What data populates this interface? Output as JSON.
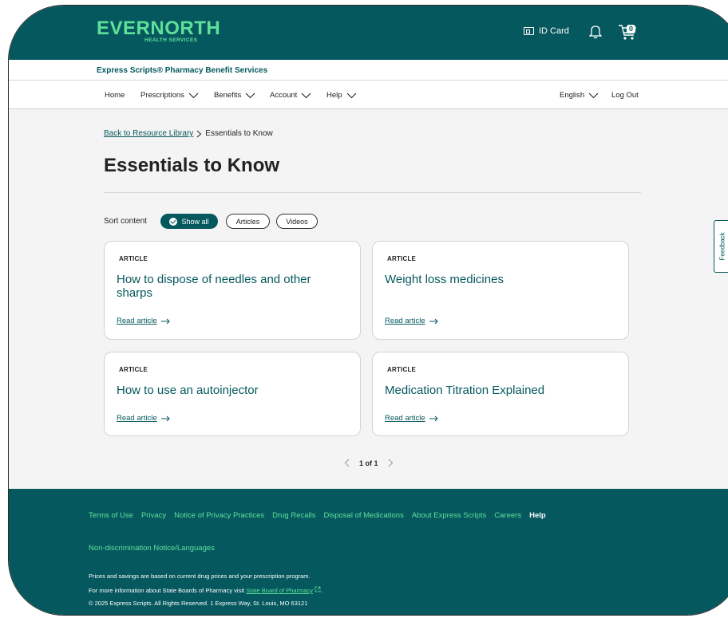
{
  "header": {
    "logo": "EVERNORTH",
    "logo_sub": "HEALTH SERVICES",
    "id_card": "ID Card",
    "cart_count": "0",
    "brand_color": "#05585e",
    "accent_color": "#5ee09a"
  },
  "subbar": {
    "title": "Express Scripts® Pharmacy Benefit Services"
  },
  "nav": {
    "items": [
      "Home",
      "Prescriptions",
      "Benefits",
      "Account",
      "Help"
    ],
    "language": "English",
    "logout": "Log Out"
  },
  "breadcrumb": {
    "back": "Back to Resource Library",
    "current": "Essentials to Know"
  },
  "page_title": "Essentials to Know",
  "sort": {
    "label": "Sort content",
    "options": [
      "Show all",
      "Articles",
      "Videos"
    ],
    "selected": "Show all"
  },
  "cards": [
    {
      "tag": "ARTICLE",
      "title": "How to dispose of needles and other sharps",
      "link": "Read article"
    },
    {
      "tag": "ARTICLE",
      "title": "Weight loss medicines",
      "link": "Read article"
    },
    {
      "tag": "ARTICLE",
      "title": "How to use an autoinjector",
      "link": "Read article"
    },
    {
      "tag": "ARTICLE",
      "title": "Medication Titration Explained",
      "link": "Read article"
    }
  ],
  "pager": {
    "text": "1 of 1"
  },
  "feedback": "Feedback",
  "footer": {
    "links": [
      "Terms of Use",
      "Privacy",
      "Notice of Privacy Practices",
      "Drug Recalls",
      "Disposal of Medications",
      "About Express Scripts",
      "Careers"
    ],
    "help": "Help",
    "nondiscrimination": "Non-discrimination Notice/Languages",
    "note1": "Prices and savings are based on current drug prices and your prescription program.",
    "note2_prefix": "For more information about State Boards of Pharmacy visit",
    "note2_link": "State Board of Pharmacy",
    "note2_suffix": ".",
    "copyright": "© 2025 Express Scripts. All Rights Reserved. 1 Express Way, St. Louis, MO 63121"
  }
}
